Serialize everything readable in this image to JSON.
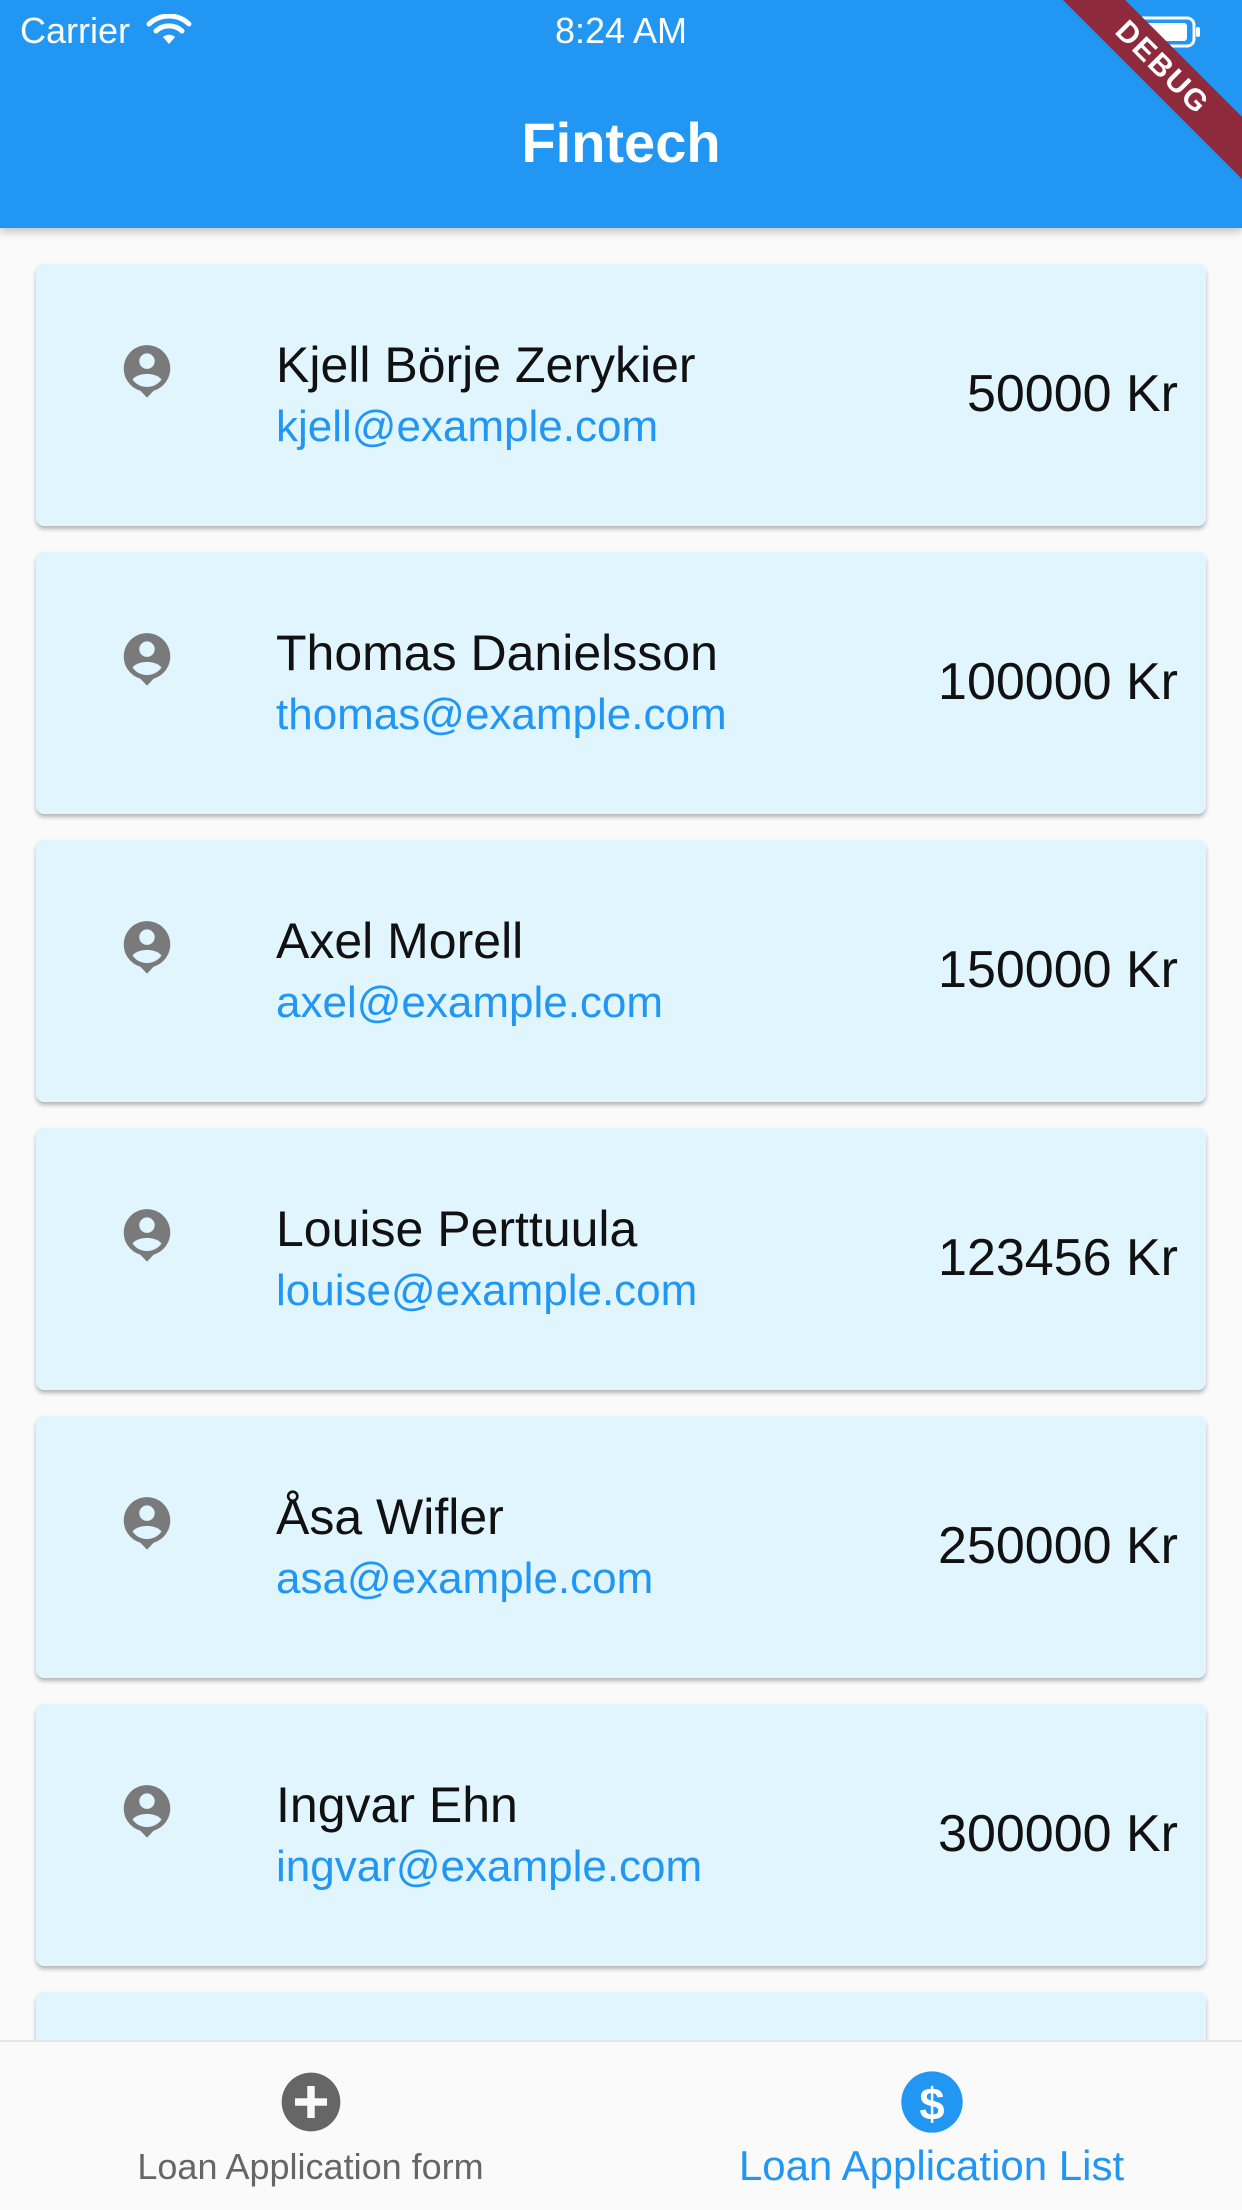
{
  "status_bar": {
    "carrier": "Carrier",
    "time": "8:24 AM"
  },
  "app_bar": {
    "title": "Fintech"
  },
  "debug_banner": "DEBUG",
  "applications": [
    {
      "name": "Kjell Börje Zerykier",
      "email": "kjell@example.com",
      "amount": "50000 Kr"
    },
    {
      "name": "Thomas Danielsson",
      "email": "thomas@example.com",
      "amount": "100000 Kr"
    },
    {
      "name": "Axel Morell",
      "email": "axel@example.com",
      "amount": "150000 Kr"
    },
    {
      "name": "Louise Perttuula",
      "email": "louise@example.com",
      "amount": "123456 Kr"
    },
    {
      "name": "Åsa Wifler",
      "email": "asa@example.com",
      "amount": "250000 Kr"
    },
    {
      "name": "Ingvar Ehn",
      "email": "ingvar@example.com",
      "amount": "300000 Kr"
    },
    {
      "name": "",
      "email": "",
      "amount": ""
    }
  ],
  "bottom_nav": {
    "items": [
      {
        "label": "Loan Application form",
        "icon": "add-circle-icon",
        "active": false
      },
      {
        "label": "Loan Application List",
        "icon": "dollar-circle-icon",
        "active": true
      }
    ]
  },
  "colors": {
    "primary": "#2196f3",
    "card": "#e1f5fe",
    "debug": "#8f2a3d",
    "inactive": "#666666"
  }
}
